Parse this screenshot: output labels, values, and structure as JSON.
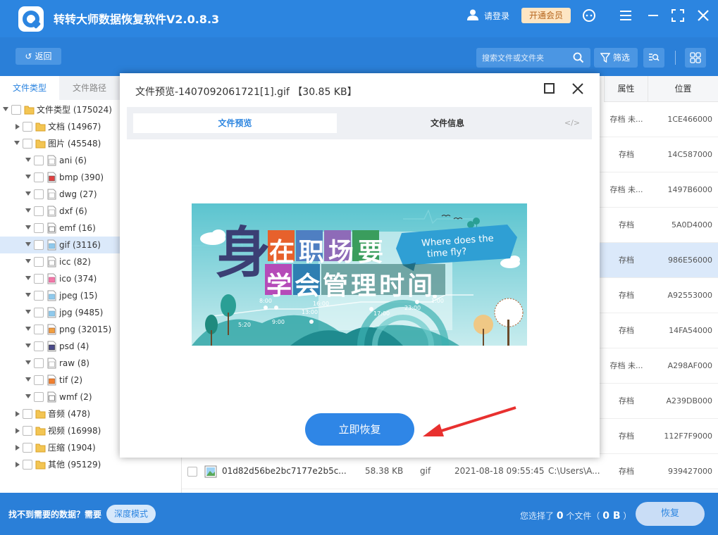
{
  "app": {
    "title": "转转大师数据恢复软件V2.0.8.3",
    "login": "请登录",
    "vip": "开通会员"
  },
  "toolbar": {
    "back": "返回",
    "search_placeholder": "搜索文件或文件夹",
    "filter": "筛选"
  },
  "sidebar": {
    "tab_type": "文件类型",
    "tab_path": "文件路径",
    "tree": [
      {
        "label": "文件类型 (175024)",
        "level": 0,
        "expanded": true,
        "folder": true
      },
      {
        "label": "文档 (14967)",
        "level": 1,
        "expanded": false,
        "folder": true
      },
      {
        "label": "图片 (45548)",
        "level": 1,
        "expanded": true,
        "folder": true
      },
      {
        "label": "ani (6)",
        "level": 2,
        "icon": "blank-file"
      },
      {
        "label": "bmp (390)",
        "level": 2,
        "icon": "bmp-file"
      },
      {
        "label": "dwg (27)",
        "level": 2,
        "icon": "blank-file"
      },
      {
        "label": "dxf (6)",
        "level": 2,
        "icon": "blank-file"
      },
      {
        "label": "emf (16)",
        "level": 2,
        "icon": "emf-file"
      },
      {
        "label": "gif (3116)",
        "level": 2,
        "icon": "image-file",
        "selected": true
      },
      {
        "label": "icc (82)",
        "level": 2,
        "icon": "icc-file"
      },
      {
        "label": "ico (374)",
        "level": 2,
        "icon": "ico-file"
      },
      {
        "label": "jpeg (15)",
        "level": 2,
        "icon": "image-file"
      },
      {
        "label": "jpg (9485)",
        "level": 2,
        "icon": "image-file"
      },
      {
        "label": "png (32015)",
        "level": 2,
        "icon": "png-file"
      },
      {
        "label": "psd (4)",
        "level": 2,
        "icon": "psd-file"
      },
      {
        "label": "raw (8)",
        "level": 2,
        "icon": "blank-file"
      },
      {
        "label": "tif (2)",
        "level": 2,
        "icon": "tif-file"
      },
      {
        "label": "wmf (2)",
        "level": 2,
        "icon": "emf-file"
      },
      {
        "label": "音频 (478)",
        "level": 1,
        "expanded": false,
        "folder": true
      },
      {
        "label": "视频 (16998)",
        "level": 1,
        "expanded": false,
        "folder": true
      },
      {
        "label": "压缩 (1904)",
        "level": 1,
        "expanded": false,
        "folder": true
      },
      {
        "label": "其他 (95129)",
        "level": 1,
        "expanded": false,
        "folder": true
      }
    ]
  },
  "table": {
    "headers": {
      "attr": "属性",
      "pos": "位置"
    },
    "rows": [
      {
        "attr": "存档 未...",
        "pos": "1CE466000"
      },
      {
        "attr": "存档",
        "pos": "14C587000"
      },
      {
        "attr": "存档 未...",
        "pos": "1497B6000"
      },
      {
        "attr": "存档",
        "pos": "5A0D4000"
      },
      {
        "attr": "存档",
        "pos": "986E56000",
        "selected": true
      },
      {
        "attr": "存档",
        "pos": "A92553000"
      },
      {
        "attr": "存档",
        "pos": "14FA54000"
      },
      {
        "attr": "存档 未...",
        "pos": "A298AF000"
      },
      {
        "attr": "存档",
        "pos": "A239DB000"
      },
      {
        "attr": "存档",
        "pos": "112F7F9000"
      }
    ],
    "last_row": {
      "name": "01d82d56be2bc7177e2b5c...",
      "size": "58.38 KB",
      "type": "gif",
      "date": "2021-08-18 09:55:45",
      "path": "C:\\Users\\A...",
      "attr": "存档",
      "pos": "939427000"
    }
  },
  "bottom": {
    "hint": "找不到需要的数据？需要",
    "deep_mode": "深度模式",
    "sel_prefix": "您选择了",
    "sel_count": "0",
    "sel_mid": "个文件（",
    "sel_size": "0 B",
    "sel_suffix": "）",
    "recover": "恢复"
  },
  "modal": {
    "title": "文件预览-1407092061721[1].gif 【30.85 KB】",
    "tab_preview": "文件预览",
    "tab_info": "文件信息",
    "tab_code": "</>",
    "restore_now": "立即恢复",
    "image": {
      "big_char": "身",
      "line1": [
        "在",
        "职",
        "场",
        "要"
      ],
      "line2": [
        "学",
        "会",
        "管",
        "理",
        "时",
        "间"
      ],
      "banner_line1": "Where does the",
      "banner_line2": "time fly?",
      "times": [
        "8:00",
        "9:00",
        "13:00",
        "16:00",
        "17:00",
        "23:00",
        "1:00",
        "5:20"
      ]
    }
  }
}
